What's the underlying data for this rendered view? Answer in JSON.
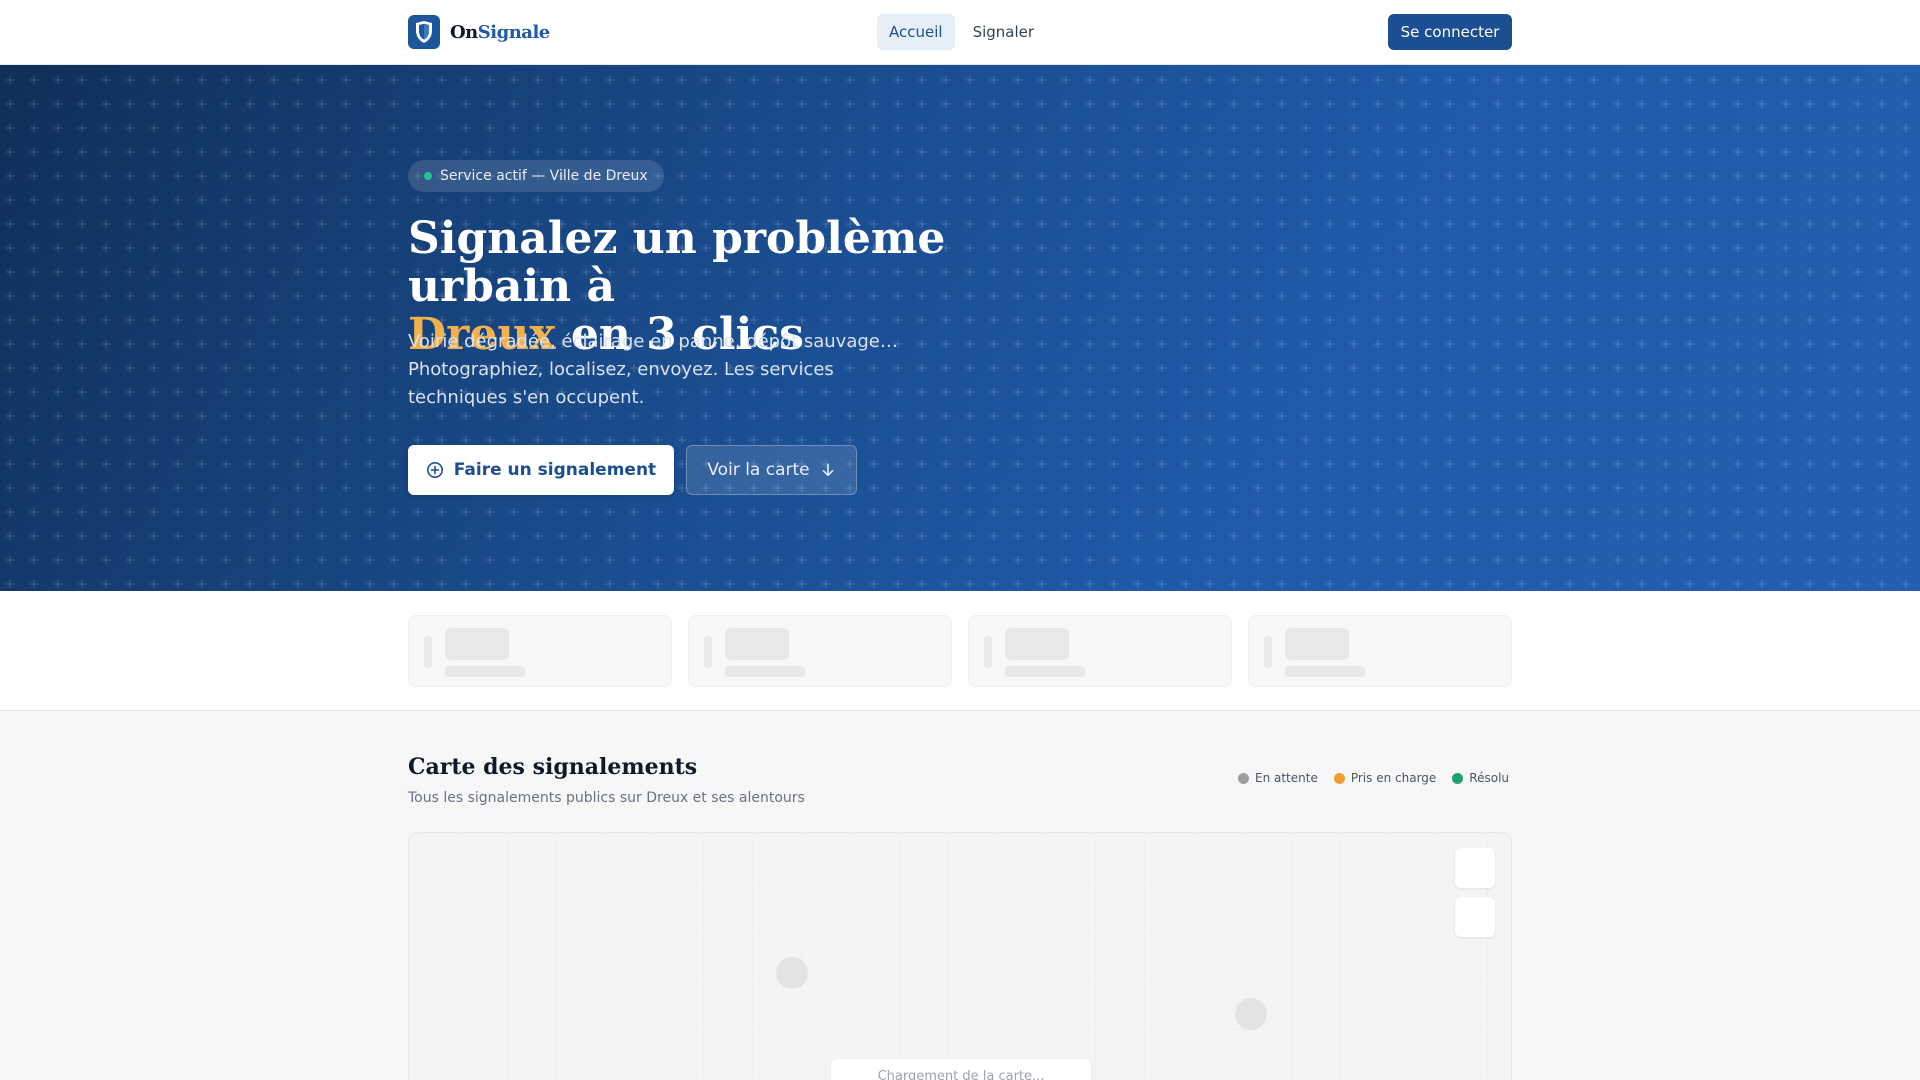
{
  "header": {
    "brand_prefix": "On",
    "brand_suffix": "Signale",
    "nav": [
      {
        "label": "Accueil",
        "active": true
      },
      {
        "label": "Signaler",
        "active": false
      }
    ],
    "login_label": "Se connecter"
  },
  "hero": {
    "badge": "Service actif — Ville de Dreux",
    "title_line1": "Signalez un problème urbain à",
    "title_highlight": "Dreux",
    "title_line2_rest": " en 3 clics",
    "subtitle": "Voirie dégradée, éclairage en panne, dépôt sauvage… Photographiez, localisez, envoyez. Les services techniques s'en occupent.",
    "primary_cta": "Faire un signalement",
    "secondary_cta": "Voir la carte"
  },
  "map_section": {
    "title": "Carte des signalements",
    "subtitle": "Tous les signalements publics sur Dreux et ses alentours",
    "legend": [
      {
        "label": "En attente",
        "color": "#9e9e9e"
      },
      {
        "label": "Pris en charge",
        "color": "#f0a030"
      },
      {
        "label": "Résolu",
        "color": "#1fa06f"
      }
    ],
    "loading_text": "Chargement de la carte..."
  },
  "colors": {
    "brand": "#1c4f91",
    "accent": "#f3b14c",
    "status_active": "#22c38e"
  }
}
